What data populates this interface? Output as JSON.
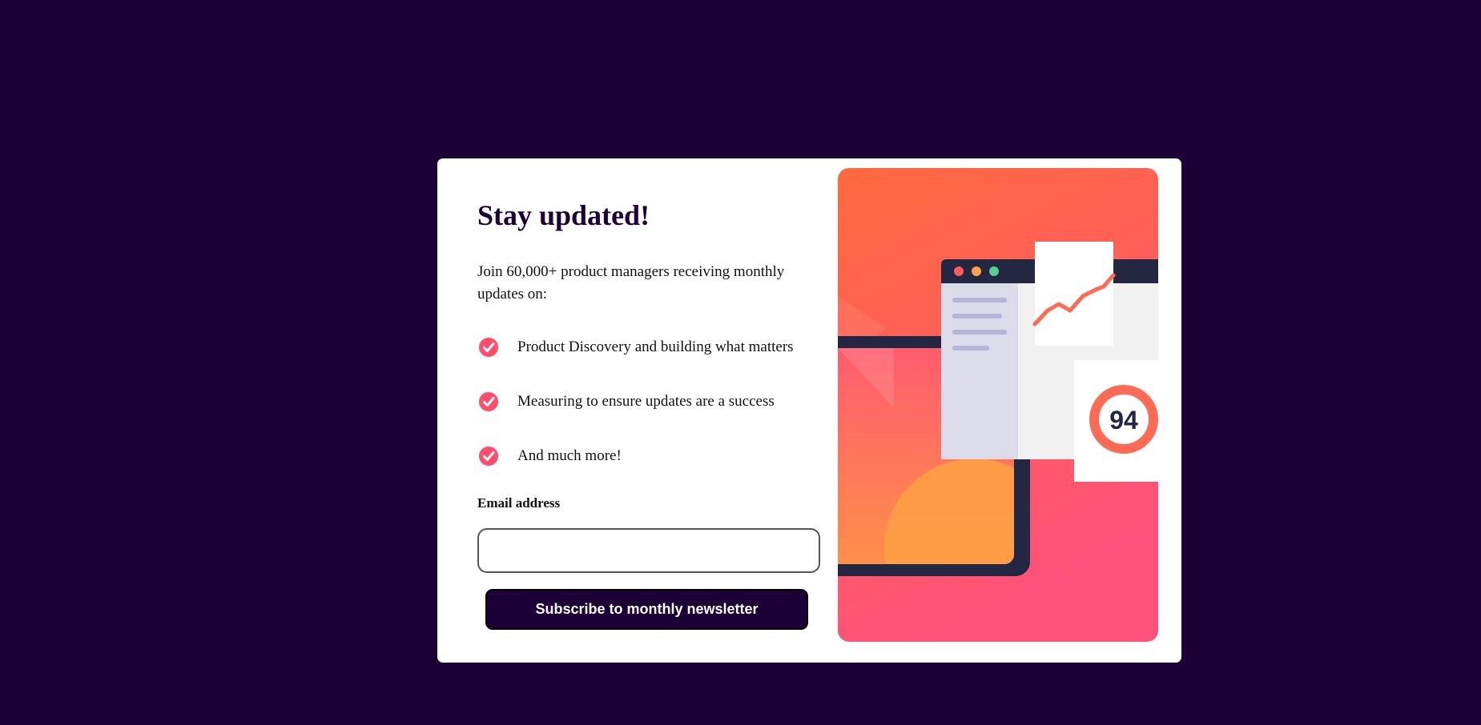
{
  "card": {
    "title": "Stay updated!",
    "intro": "Join 60,000+ product managers receiving monthly updates on:",
    "features": [
      {
        "text": "Product Discovery and building what matters",
        "icon": "check-circle-icon"
      },
      {
        "text": "Measuring to ensure updates are a success",
        "icon": "check-circle-icon"
      },
      {
        "text": "And much more!",
        "icon": "check-circle-icon"
      }
    ],
    "email": {
      "label": "Email address",
      "value": "",
      "placeholder": ""
    },
    "subscribe_label": "Subscribe to monthly newsletter"
  },
  "illustration": {
    "score": "94"
  },
  "colors": {
    "background": "#1d0136",
    "card": "#ffffff",
    "check": "#ff4e6b",
    "gradient_top": "#ff6a3d",
    "gradient_bottom": "#ff527b",
    "button": "#1d0136"
  }
}
